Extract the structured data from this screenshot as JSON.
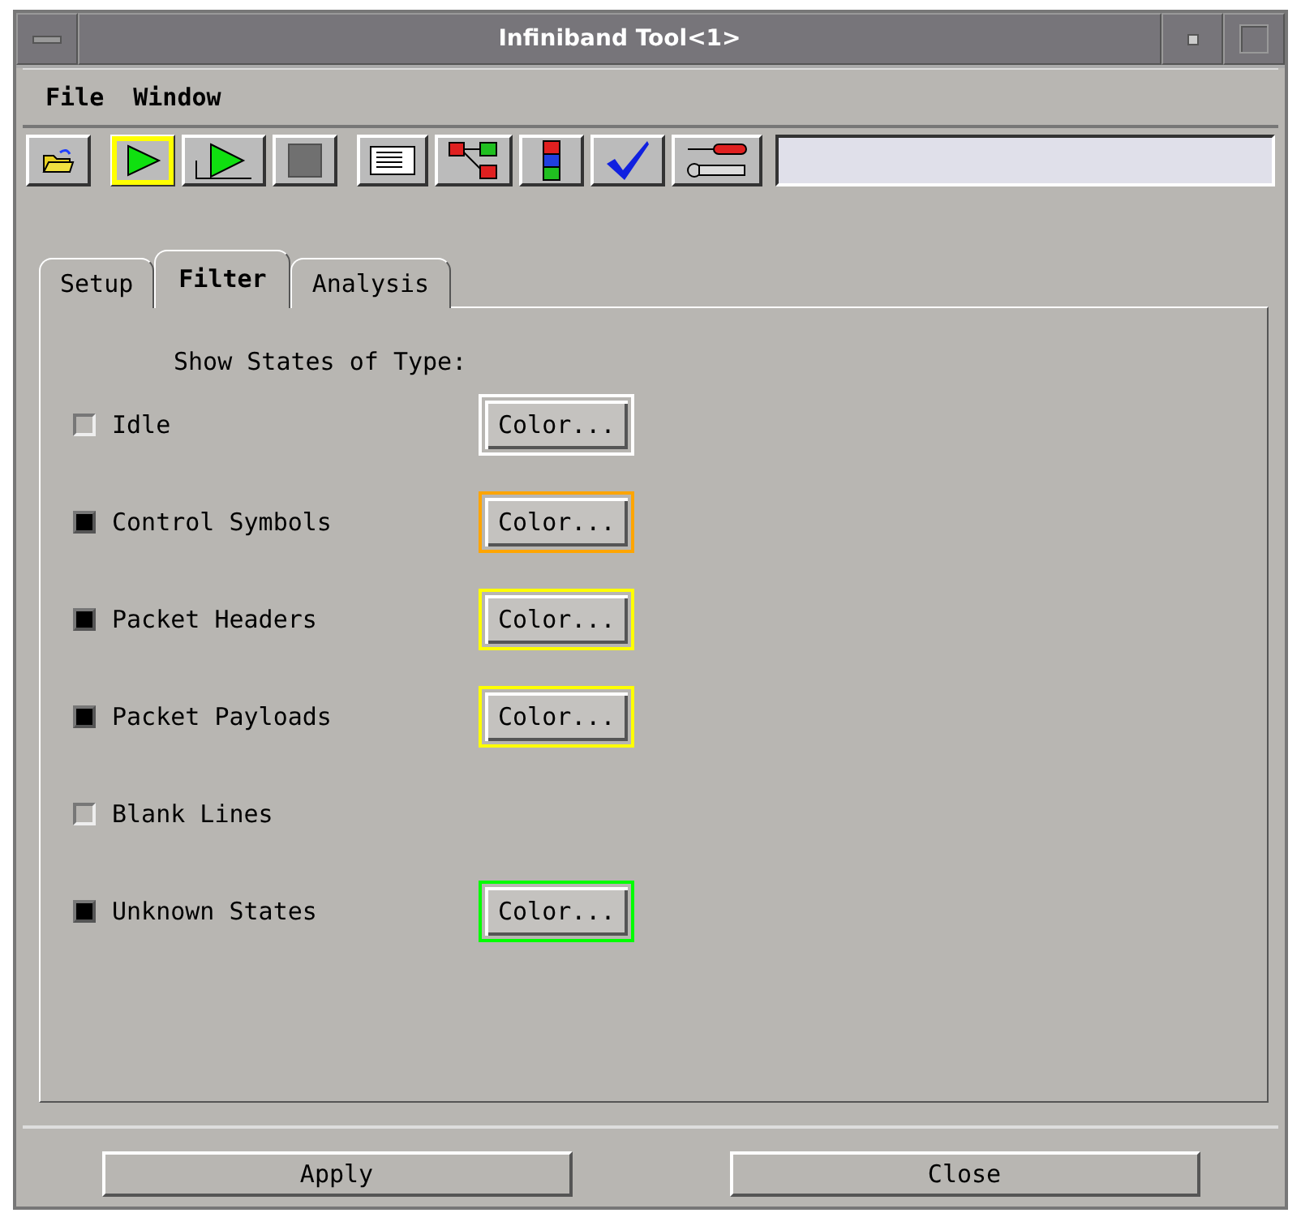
{
  "window": {
    "title": "Infiniband Tool<1>"
  },
  "menu": [
    "File",
    "Window"
  ],
  "toolbar": [
    {
      "kind": "open",
      "selected": false
    },
    {
      "kind": "run",
      "selected": true
    },
    {
      "kind": "repeat",
      "selected": false
    },
    {
      "kind": "stop",
      "selected": false
    },
    {
      "kind": "listing",
      "selected": false
    },
    {
      "kind": "tree",
      "selected": false
    },
    {
      "kind": "node",
      "selected": false
    },
    {
      "kind": "check",
      "selected": false
    },
    {
      "kind": "tools",
      "selected": false
    }
  ],
  "tabs": [
    {
      "label": "Setup",
      "selected": false
    },
    {
      "label": "Filter",
      "selected": true
    },
    {
      "label": "Analysis",
      "selected": false
    }
  ],
  "heading": "Show States of Type:",
  "filters": [
    {
      "label": "Idle",
      "checked": false,
      "button": "Color...",
      "color": "#ffffff"
    },
    {
      "label": "Control Symbols",
      "checked": true,
      "button": "Color...",
      "color": "#ffa500"
    },
    {
      "label": "Packet Headers",
      "checked": true,
      "button": "Color...",
      "color": "#ffff00"
    },
    {
      "label": "Packet Payloads",
      "checked": true,
      "button": "Color...",
      "color": "#ffff00"
    },
    {
      "label": "Blank Lines",
      "checked": false
    },
    {
      "label": "Unknown States",
      "checked": true,
      "button": "Color...",
      "color": "#00ff00"
    }
  ],
  "buttons": [
    "Apply",
    "Close"
  ]
}
